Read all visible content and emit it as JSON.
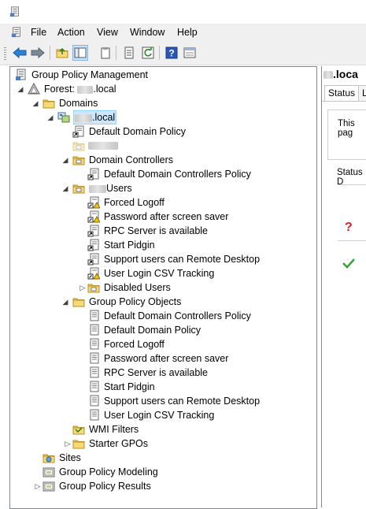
{
  "menu": {
    "items": [
      "File",
      "Action",
      "View",
      "Window",
      "Help"
    ]
  },
  "toolbar": {
    "buttons": [
      "back-icon",
      "forward-icon",
      "up-folder-icon",
      "show-hide-tree-icon",
      "clipboard-icon",
      "properties-icon",
      "refresh-icon",
      "help-icon",
      "console-pane-icon"
    ]
  },
  "tree": {
    "root": "Group Policy Management",
    "forest": "Forest:",
    "forest_suffix": ".local",
    "domains": "Domains",
    "domain_suffix": ".local",
    "default_domain_policy": "Default Domain Policy",
    "domain_controllers": "Domain Controllers",
    "dc_policy": "Default Domain Controllers Policy",
    "users_suffix": "Users",
    "users_links": [
      "Forced Logoff",
      "Password after screen saver",
      "RPC Server is available",
      "Start Pidgin",
      "Support users can Remote Desktop",
      "User Login CSV Tracking"
    ],
    "disabled_users": "Disabled Users",
    "gpo_container": "Group Policy Objects",
    "gpos": [
      "Default Domain Controllers Policy",
      "Default Domain Policy",
      "Forced Logoff",
      "Password after screen saver",
      "RPC Server is available",
      "Start Pidgin",
      "Support users can Remote Desktop",
      "User Login CSV Tracking"
    ],
    "wmi_filters": "WMI Filters",
    "starter_gpos": "Starter GPOs",
    "sites": "Sites",
    "modeling": "Group Policy Modeling",
    "results": "Group Policy Results"
  },
  "right_pane": {
    "title": ".loca",
    "tabs": [
      "Status",
      "L"
    ],
    "info_text": "This pag",
    "status_label": "Status D",
    "status_icons": [
      "question-icon",
      "checkmark-icon"
    ]
  },
  "colors": {
    "folder": "#e8c45a",
    "selection": "#cce8ff",
    "question": "#d22020",
    "check": "#3aa33a"
  }
}
